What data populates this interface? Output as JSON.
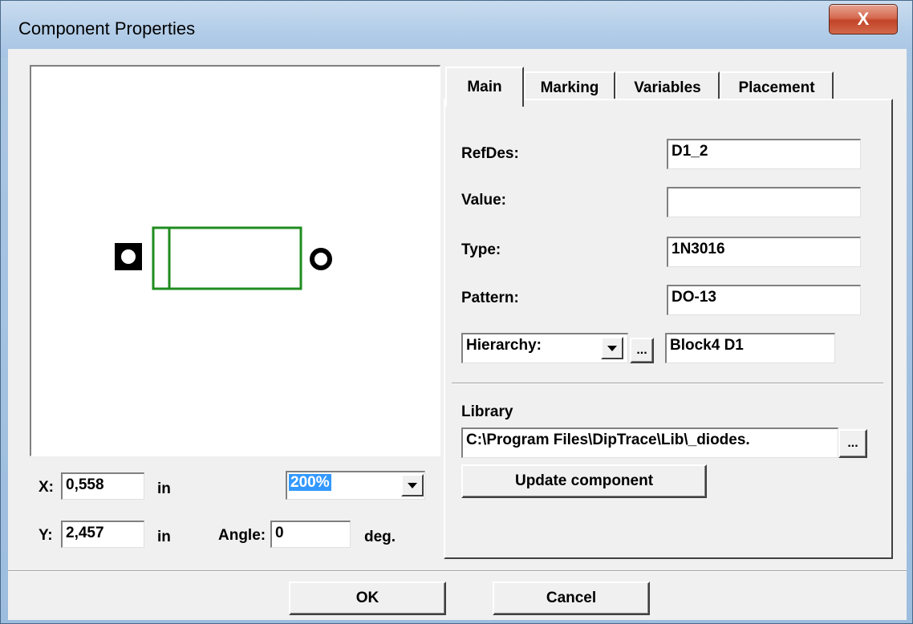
{
  "window": {
    "title": "Component Properties",
    "close_glyph": "X"
  },
  "position": {
    "x_label": "X:",
    "x_value": "0,558",
    "x_unit": "in",
    "y_label": "Y:",
    "y_value": "2,457",
    "y_unit": "in",
    "angle_label": "Angle:",
    "angle_value": "0",
    "angle_unit": "deg."
  },
  "zoom": {
    "value": "200%"
  },
  "preview": {
    "outline_color": "#1f8c1f",
    "pad_color": "#000000"
  },
  "tabs": [
    {
      "label": "Main",
      "active": true
    },
    {
      "label": "Marking",
      "active": false
    },
    {
      "label": "Variables",
      "active": false
    },
    {
      "label": "Placement",
      "active": false
    }
  ],
  "main": {
    "refdes_label": "RefDes:",
    "refdes_value": "D1_2",
    "value_label": "Value:",
    "value_value": "",
    "type_label": "Type:",
    "type_value": "1N3016",
    "pattern_label": "Pattern:",
    "pattern_value": "DO-13",
    "hierarchy_option": "Hierarchy:",
    "hierarchy_browse": "...",
    "hierarchy_value": "Block4 D1",
    "library_label": "Library",
    "library_path": "C:\\Program Files\\DipTrace\\Lib\\_diodes.",
    "library_browse": "...",
    "update_button": "Update component"
  },
  "footer": {
    "ok": "OK",
    "cancel": "Cancel"
  }
}
